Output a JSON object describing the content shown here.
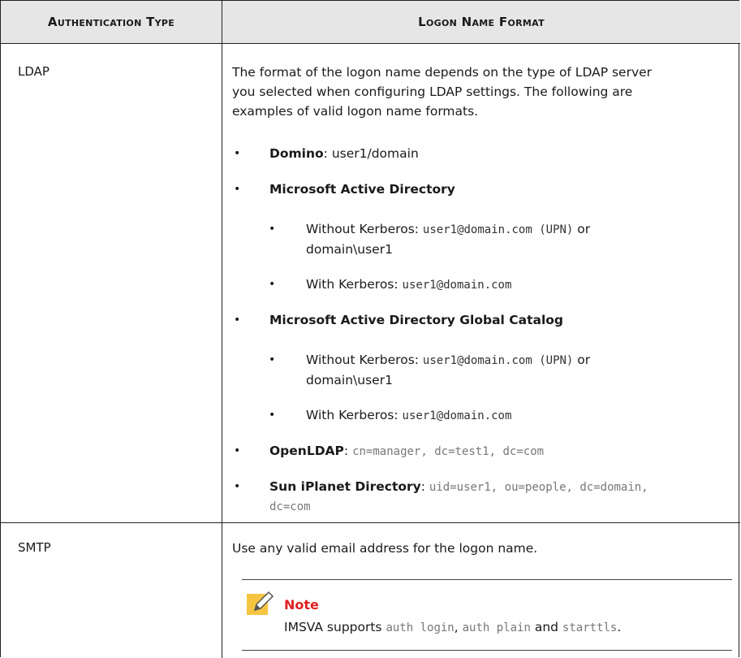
{
  "headers": {
    "auth_type": "Authentication Type",
    "logon_format": "Logon Name Format"
  },
  "ldap": {
    "type": "LDAP",
    "intro_line1": "The format of the logon name depends on the type of LDAP server",
    "intro_line2": "you selected when configuring LDAP settings. The following are",
    "intro_line3": "examples of valid logon name formats.",
    "domino_label": "Domino",
    "domino_value": ": user1/domain",
    "msad_label": "Microsoft Active Directory",
    "msad_without_prefix": "Without Kerberos: ",
    "msad_without_code": "user1@domain.com (UPN)",
    "msad_without_or": " or",
    "msad_without_line2": "domain\\user1",
    "msad_with_prefix": "With Kerberos: ",
    "msad_with_code": "user1@domain.com",
    "msadgc_label": "Microsoft Active Directory Global Catalog",
    "msadgc_without_prefix": "Without Kerberos: ",
    "msadgc_without_code": "user1@domain.com (UPN)",
    "msadgc_without_or": " or",
    "msadgc_without_line2": "domain\\user1",
    "msadgc_with_prefix": "With Kerberos: ",
    "msadgc_with_code": "user1@domain.com",
    "openldap_label": "OpenLDAP",
    "openldap_colon": ": ",
    "openldap_value": "cn=manager, dc=test1, dc=com",
    "sun_label": "Sun iPlanet Directory",
    "sun_colon": ": ",
    "sun_value_line1": "uid=user1, ou=people, dc=domain,",
    "sun_value_line2": "dc=com"
  },
  "smtp": {
    "type": "SMTP",
    "text": "Use any valid email address for the logon name.",
    "note_title": "Note",
    "note_prefix": "IMSVA supports ",
    "note_code1": "auth login",
    "note_sep1": ", ",
    "note_code2": "auth plain",
    "note_and": " and ",
    "note_code3": "starttls",
    "note_end": "."
  },
  "colors": {
    "header_bg": "#e6e6e6",
    "note_red": "#e02020",
    "note_icon_yellow": "#f5c542"
  },
  "icons": {
    "bullet": "•",
    "note": "note-pencil-icon"
  }
}
